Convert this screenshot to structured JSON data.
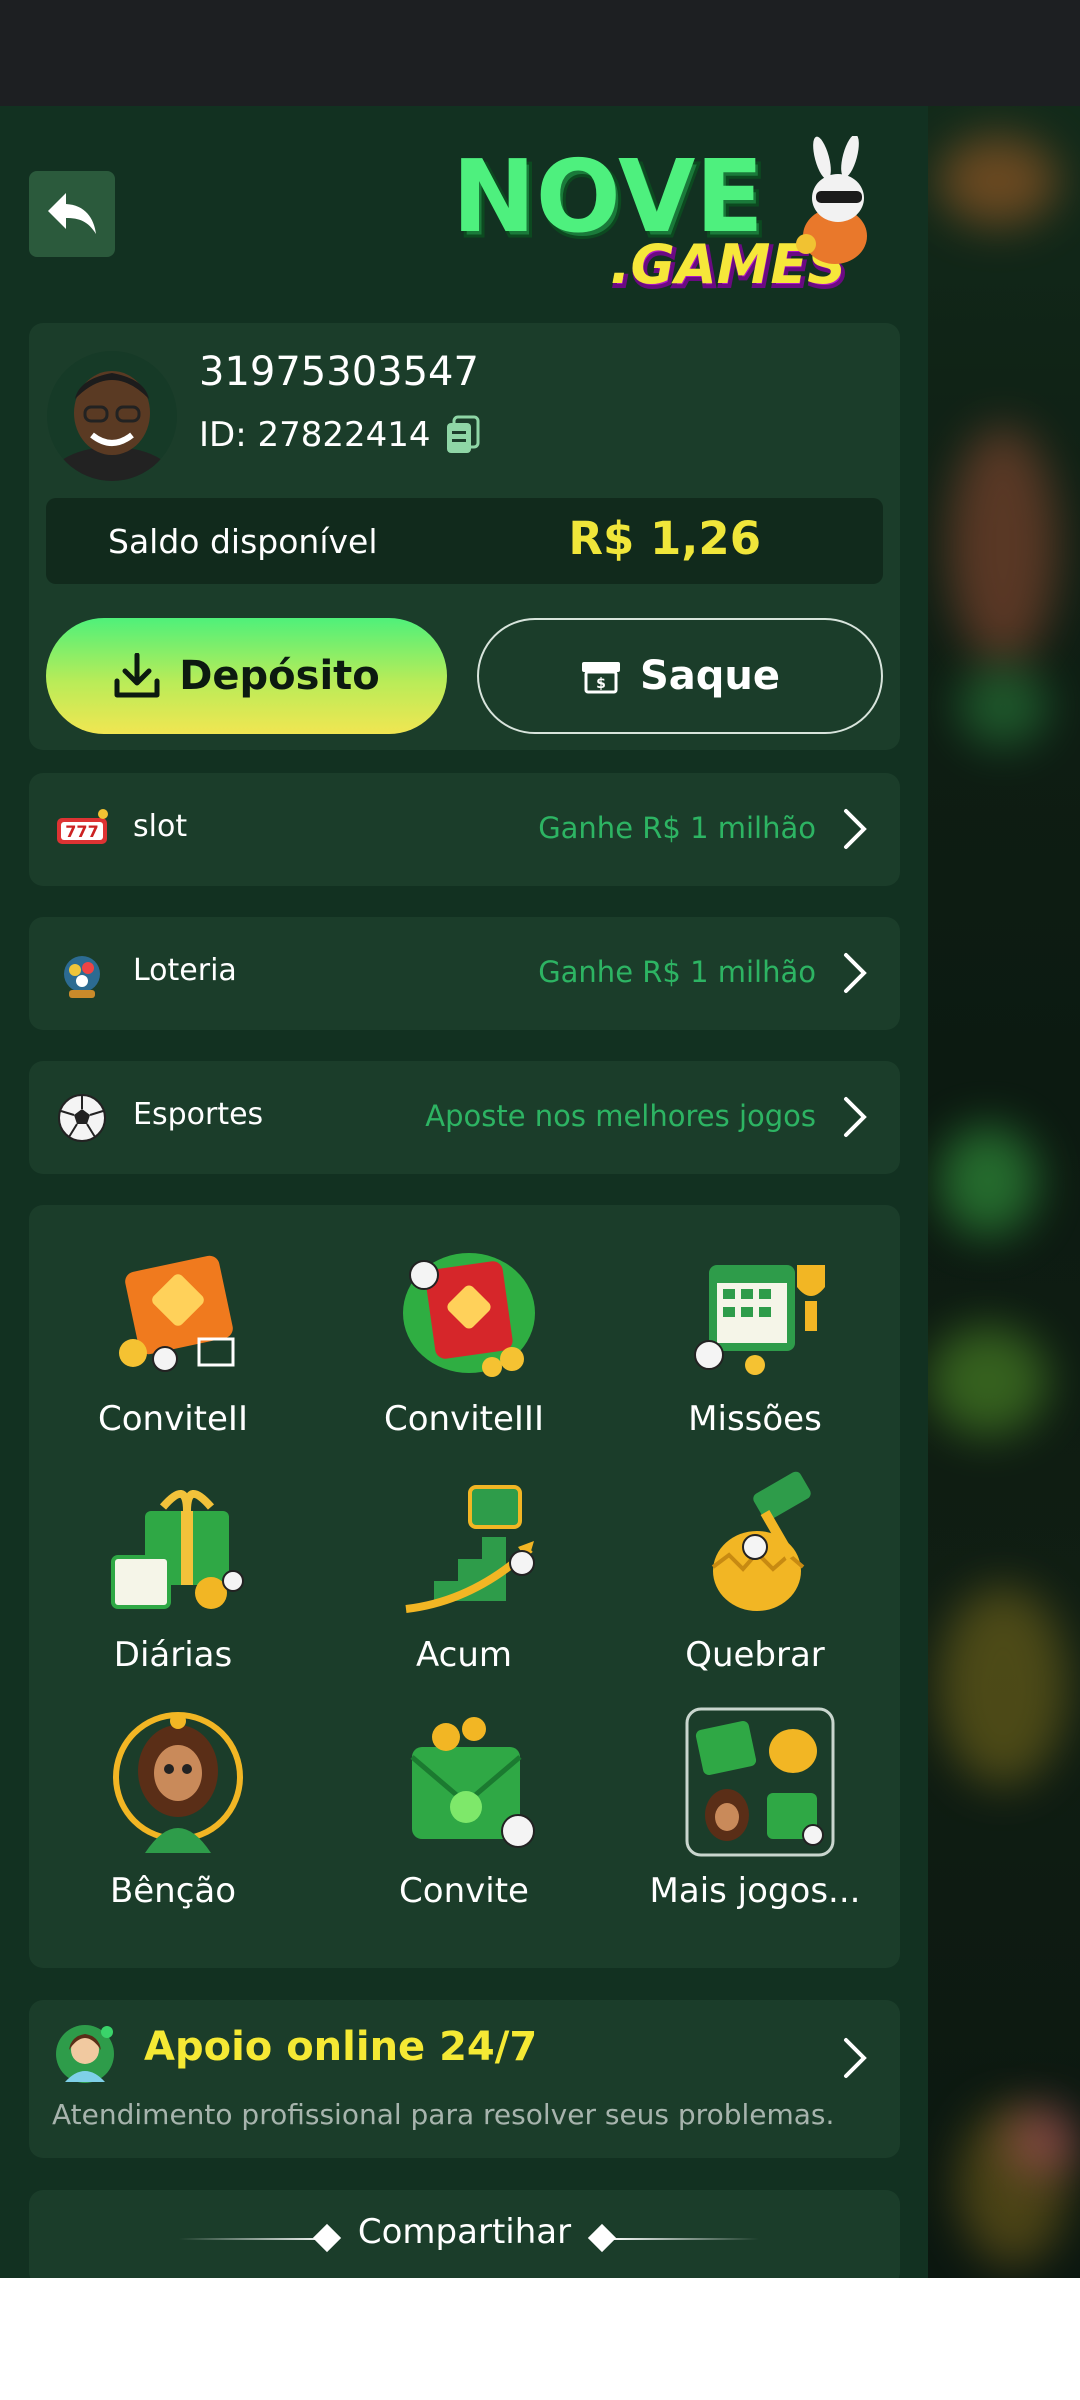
{
  "header": {
    "back_icon": "reply-arrow-icon",
    "logo_text": "NOVE",
    "logo_suffix": ".GAMES"
  },
  "profile": {
    "phone": "31975303547",
    "id_text": "ID: 27822414",
    "balance_label": "Saldo disponível",
    "balance_value": "R$ 1,26",
    "deposit_label": "Depósito",
    "withdraw_label": "Saque"
  },
  "rows": [
    {
      "label": "slot",
      "promo": "Ganhe R$ 1 milhão",
      "icon": "slot-777-icon"
    },
    {
      "label": "Loteria",
      "promo": "Ganhe R$ 1 milhão",
      "icon": "lottery-icon"
    },
    {
      "label": "Esportes",
      "promo": "Aposte nos melhores jogos",
      "icon": "soccer-ball-icon"
    }
  ],
  "grid": [
    {
      "label": "ConviteII",
      "icon": "invite-envelope-orange-icon"
    },
    {
      "label": "ConviteIII",
      "icon": "invite-envelope-red-icon"
    },
    {
      "label": "Missões",
      "icon": "missions-calendar-trophy-icon"
    },
    {
      "label": "Diárias",
      "icon": "daily-gift-calendar-icon"
    },
    {
      "label": "Acum",
      "icon": "stairs-chest-icon"
    },
    {
      "label": "Quebrar",
      "icon": "golden-egg-hammer-icon"
    },
    {
      "label": "Bênção",
      "icon": "blessing-goddess-icon"
    },
    {
      "label": "Convite",
      "icon": "invite-envelope-green-icon"
    },
    {
      "label": "Mais jogos...",
      "icon": "more-games-icon"
    }
  ],
  "support": {
    "title": "Apoio online 24/7",
    "subtitle": "Atendimento profissional para resolver seus problemas."
  },
  "share": {
    "label": "Compartihar"
  },
  "colors": {
    "panel": "#123121",
    "card": "#1b3d2a",
    "accent_yellow": "#f0e63a",
    "promo_green": "#2db463"
  }
}
